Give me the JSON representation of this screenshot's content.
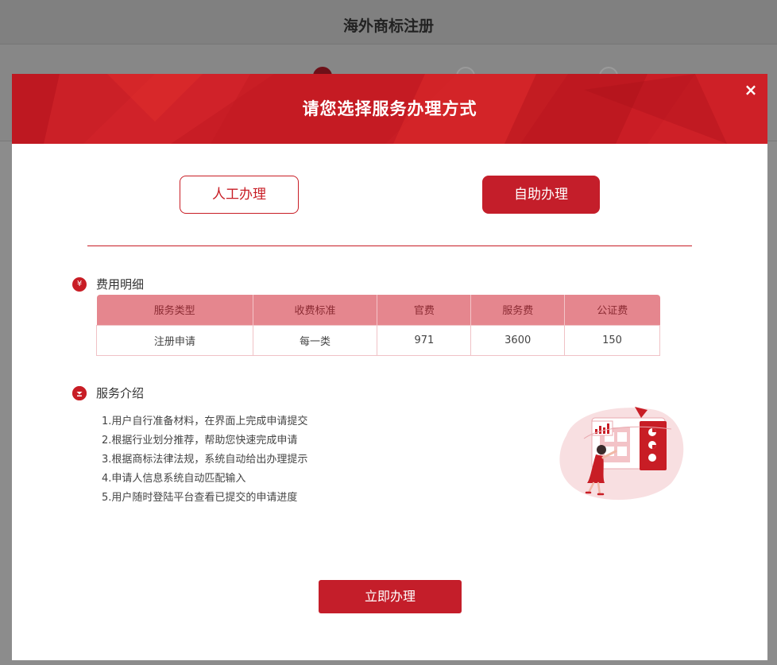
{
  "background_page": {
    "title": "海外商标注册"
  },
  "modal": {
    "title": "请您选择服务办理方式",
    "close_symbol": "×",
    "modes": {
      "manual_label": "人工办理",
      "self_label": "自助办理",
      "selected": "自助办理"
    },
    "fee_section": {
      "icon": "yen-icon",
      "icon_symbol": "¥",
      "title": "费用明细",
      "columns": [
        "服务类型",
        "收费标准",
        "官费",
        "服务费",
        "公证费"
      ],
      "rows": [
        [
          "注册申请",
          "每一类",
          "971",
          "3600",
          "150"
        ]
      ]
    },
    "intro_section": {
      "icon": "service-badge-icon",
      "title": "服务介绍",
      "items": [
        "1.用户自行准备材料，在界面上完成申请提交",
        "2.根据行业划分推荐，帮助您快速完成申请",
        "3.根据商标法律法规，系统自动给出办理提示",
        "4.申请人信息系统自动匹配输入",
        "5.用户随时登陆平台查看已提交的申请进度"
      ]
    },
    "submit_label": "立即办理"
  },
  "colors": {
    "brand_red": "#c81d25",
    "button_red": "#c41e2a",
    "table_header": "#e5868e"
  }
}
